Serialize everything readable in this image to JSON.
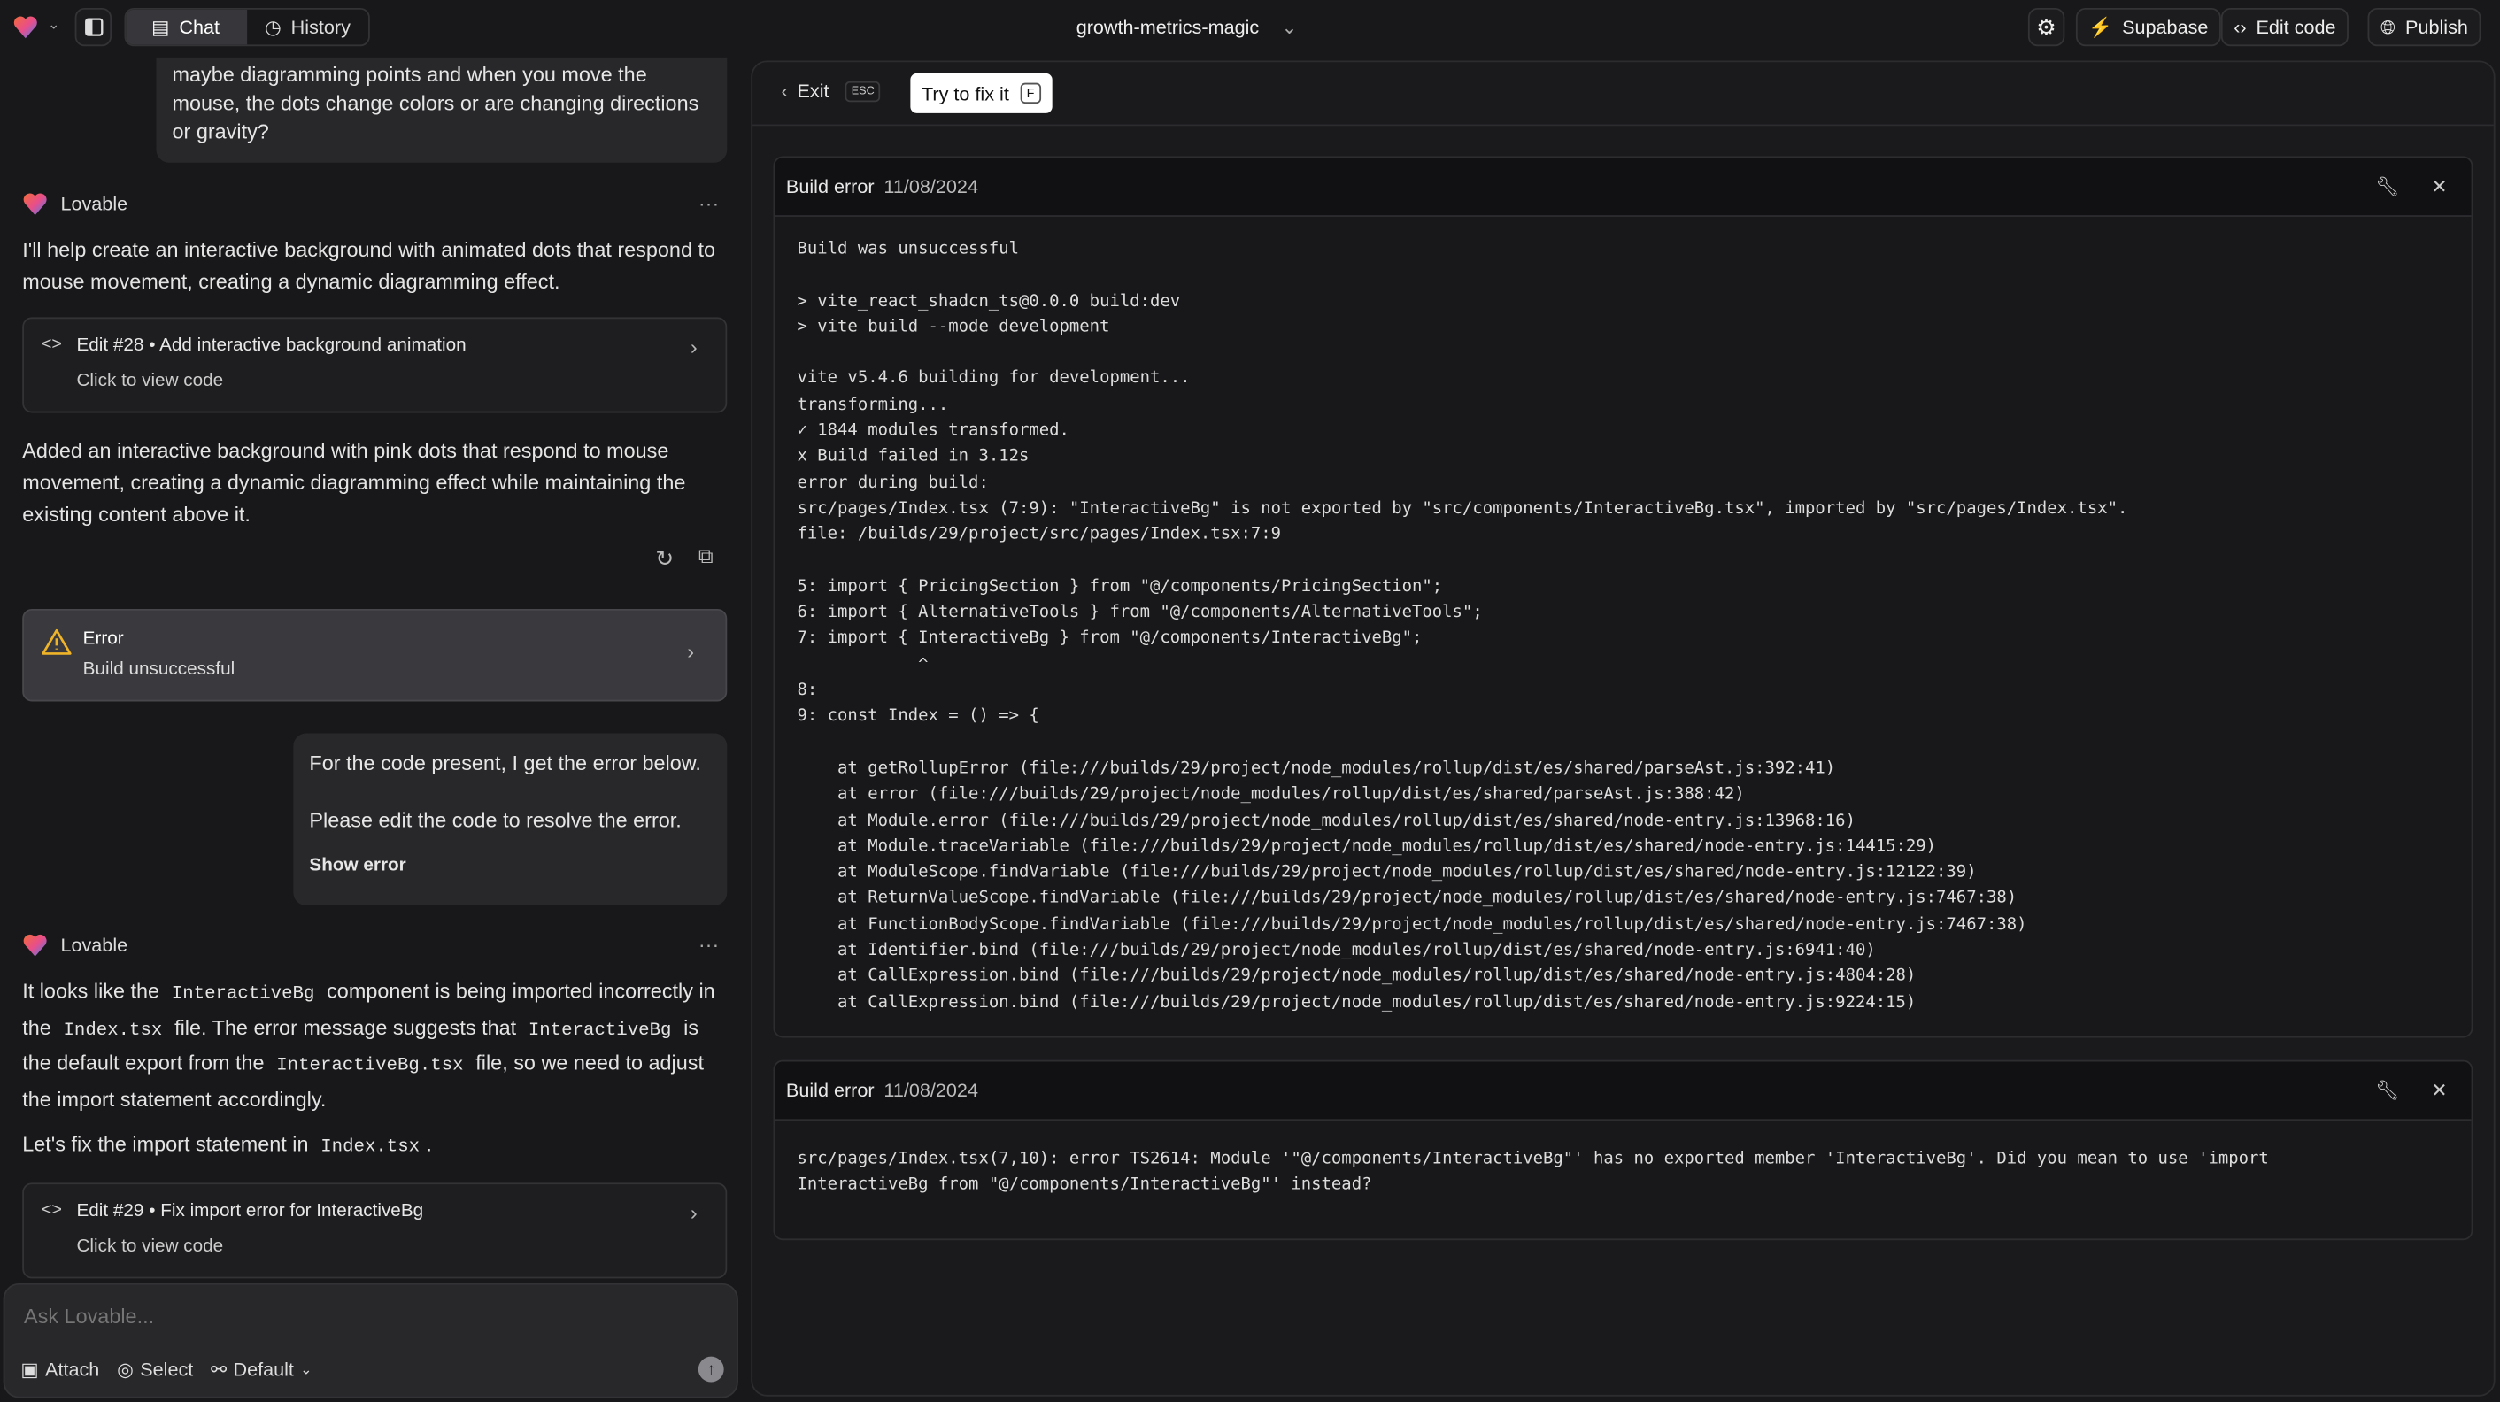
{
  "topbar": {
    "tabs": [
      {
        "label": "Chat",
        "icon": "chat-icon",
        "active": true
      },
      {
        "label": "History",
        "icon": "history-icon"
      }
    ],
    "project_title": "growth-metrics-magic",
    "buttons": {
      "settings": "gear-icon",
      "supabase": "Supabase",
      "edit_code": "Edit code",
      "publish": "Publish"
    },
    "colors": {
      "supabase": "#3ecf8e"
    }
  },
  "chat": {
    "messages": [
      {
        "role": "user",
        "text": "maybe diagramming points and when you move the mouse, the dots change colors or are changing directions or gravity?"
      },
      {
        "role": "assistant",
        "author": "Lovable",
        "text": "I'll help create an interactive background with animated dots that respond to mouse movement, creating a dynamic diagramming effect.",
        "edit": {
          "title": "Edit #28 • Add interactive background animation",
          "subtitle": "Click to view code"
        },
        "text2": "Added an interactive background with pink dots that respond to mouse movement, creating a dynamic diagramming effect while maintaining the existing content above it."
      },
      {
        "role": "error",
        "title": "Error",
        "subtitle": "Build unsuccessful"
      },
      {
        "role": "user",
        "line1": "For the code present, I get the error below.",
        "line2": "Please edit the code to resolve the error.",
        "link": "Show error"
      },
      {
        "role": "assistant",
        "author": "Lovable",
        "segments": [
          "It looks like the ",
          "InteractiveBg",
          " component is being imported incorrectly in the ",
          "Index.tsx",
          " file. The error message suggests that ",
          "InteractiveBg",
          " is the default export from the ",
          "InteractiveBg.tsx",
          " file, so we need to adjust the import statement accordingly."
        ],
        "segments2": [
          "Let's fix the import statement in ",
          "Index.tsx",
          "."
        ],
        "edit": {
          "title": "Edit #29 • Fix import error for InteractiveBg",
          "subtitle": "Click to view code"
        }
      }
    ]
  },
  "input": {
    "placeholder": "Ask Lovable...",
    "attach": "Attach",
    "select": "Select",
    "mode": "Default"
  },
  "preview": {
    "exit": "Exit",
    "exit_key": "ESC",
    "fix": "Try to fix it",
    "fix_key": "F",
    "build_errors": [
      {
        "label": "Build error",
        "date": "11/08/2024",
        "log": [
          "Build was unsuccessful",
          "",
          "> vite_react_shadcn_ts@0.0.0 build:dev",
          "> vite build --mode development",
          "",
          "vite v5.4.6 building for development...",
          "transforming...",
          "✓ 1844 modules transformed.",
          "x Build failed in 3.12s",
          "error during build:",
          "src/pages/Index.tsx (7:9): \"InteractiveBg\" is not exported by \"src/components/InteractiveBg.tsx\", imported by \"src/pages/Index.tsx\".",
          "file: /builds/29/project/src/pages/Index.tsx:7:9",
          "",
          "5: import { PricingSection } from \"@/components/PricingSection\";",
          "6: import { AlternativeTools } from \"@/components/AlternativeTools\";",
          "7: import { InteractiveBg } from \"@/components/InteractiveBg\";",
          "            ^",
          "8: ",
          "9: const Index = () => {",
          "",
          "    at getRollupError (file:///builds/29/project/node_modules/rollup/dist/es/shared/parseAst.js:392:41)",
          "    at error (file:///builds/29/project/node_modules/rollup/dist/es/shared/parseAst.js:388:42)",
          "    at Module.error (file:///builds/29/project/node_modules/rollup/dist/es/shared/node-entry.js:13968:16)",
          "    at Module.traceVariable (file:///builds/29/project/node_modules/rollup/dist/es/shared/node-entry.js:14415:29)",
          "    at ModuleScope.findVariable (file:///builds/29/project/node_modules/rollup/dist/es/shared/node-entry.js:12122:39)",
          "    at ReturnValueScope.findVariable (file:///builds/29/project/node_modules/rollup/dist/es/shared/node-entry.js:7467:38)",
          "    at FunctionBodyScope.findVariable (file:///builds/29/project/node_modules/rollup/dist/es/shared/node-entry.js:7467:38)",
          "    at Identifier.bind (file:///builds/29/project/node_modules/rollup/dist/es/shared/node-entry.js:6941:40)",
          "    at CallExpression.bind (file:///builds/29/project/node_modules/rollup/dist/es/shared/node-entry.js:4804:28)",
          "    at CallExpression.bind (file:///builds/29/project/node_modules/rollup/dist/es/shared/node-entry.js:9224:15)"
        ]
      },
      {
        "label": "Build error",
        "date": "11/08/2024",
        "log": [
          "src/pages/Index.tsx(7,10): error TS2614: Module '\"@/components/InteractiveBg\"' has no exported member 'InteractiveBg'. Did you mean to use 'import",
          "InteractiveBg from \"@/components/InteractiveBg\"' instead?"
        ]
      }
    ]
  }
}
